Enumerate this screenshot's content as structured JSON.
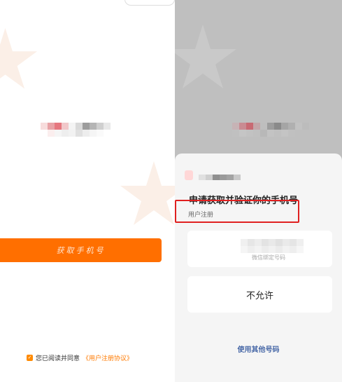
{
  "left_panel": {
    "get_number_button": "获取手机号",
    "agreement_text": "您已阅读并同意",
    "agreement_link": "《用户注册协议》"
  },
  "sheet": {
    "title": "申请获取并验证你的手机号",
    "subtitle": "用户注册",
    "phone_caption": "微信绑定号码",
    "deny_label": "不允许",
    "other_number_label": "使用其他号码"
  },
  "colors": {
    "accent_orange": "#ff6f00",
    "highlight_red": "#e02020",
    "link_blue": "#4a6aa8"
  }
}
